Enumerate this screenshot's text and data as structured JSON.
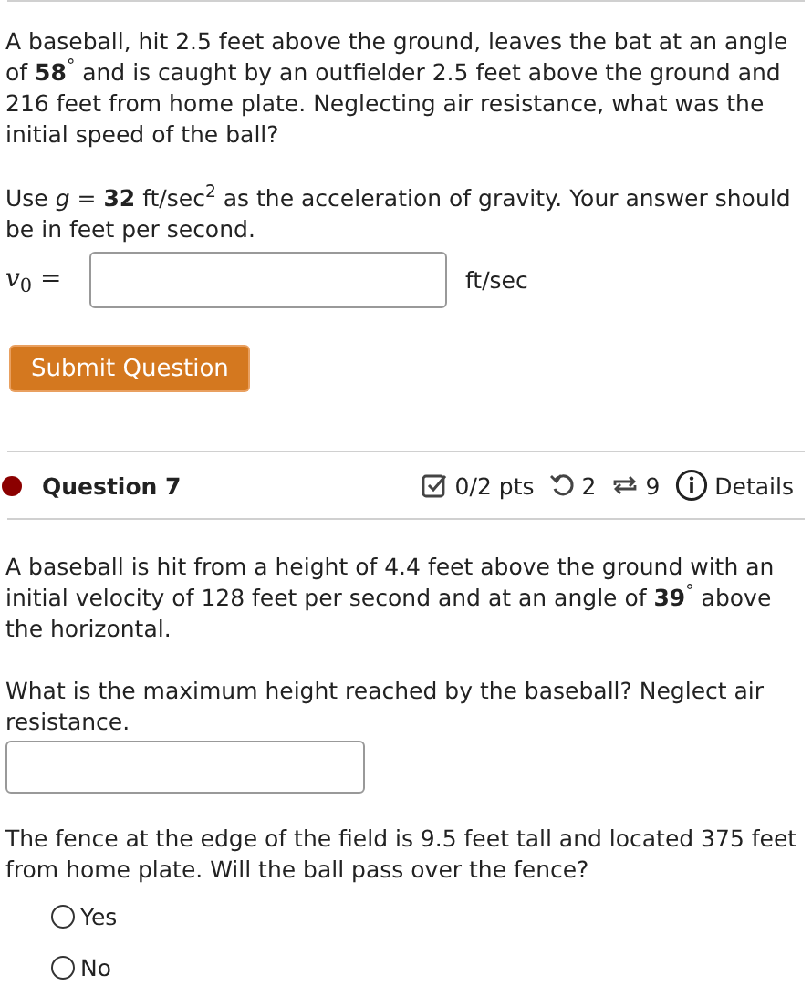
{
  "previous_question": {
    "paragraphs": [
      "A baseball, hit 2.5 feet above the ground, leaves the bat at an angle of **58**$^{°}$ and is caught by an outfielder 2.5 feet above the ground and 216 feet from home plate. Neglecting air resistance, what was the initial speed of the ball?",
      "Use *g* = **32** ft/sec$^{2}$ as the acceleration of gravity. Your answer should be in feet per second."
    ],
    "answer": {
      "label": "*v*$_{0}$ =",
      "unit": "ft/sec"
    },
    "submit_button": "Submit Question"
  },
  "question": {
    "title": "Question 7",
    "color": "#8b0000",
    "score": "0/2 pts",
    "retries": "2",
    "attempts": "9",
    "details": "Details",
    "paragraph_1": "A baseball is hit from a height of 4.4 feet above the ground with an initial velocity of 128 feet per second and at an angle of **39**$^{°}$ above the horizontal.",
    "paragraph_2": "What is the maximum height reached by the baseball? Neglect air resistance.",
    "paragraph_3": "The fence at the edge of the field is 9.5 feet tall and located 375 feet from home plate. Will the ball pass over the fence?",
    "options": [
      {
        "label": "Yes",
        "selected": false
      },
      {
        "label": "No",
        "selected": false
      }
    ]
  }
}
